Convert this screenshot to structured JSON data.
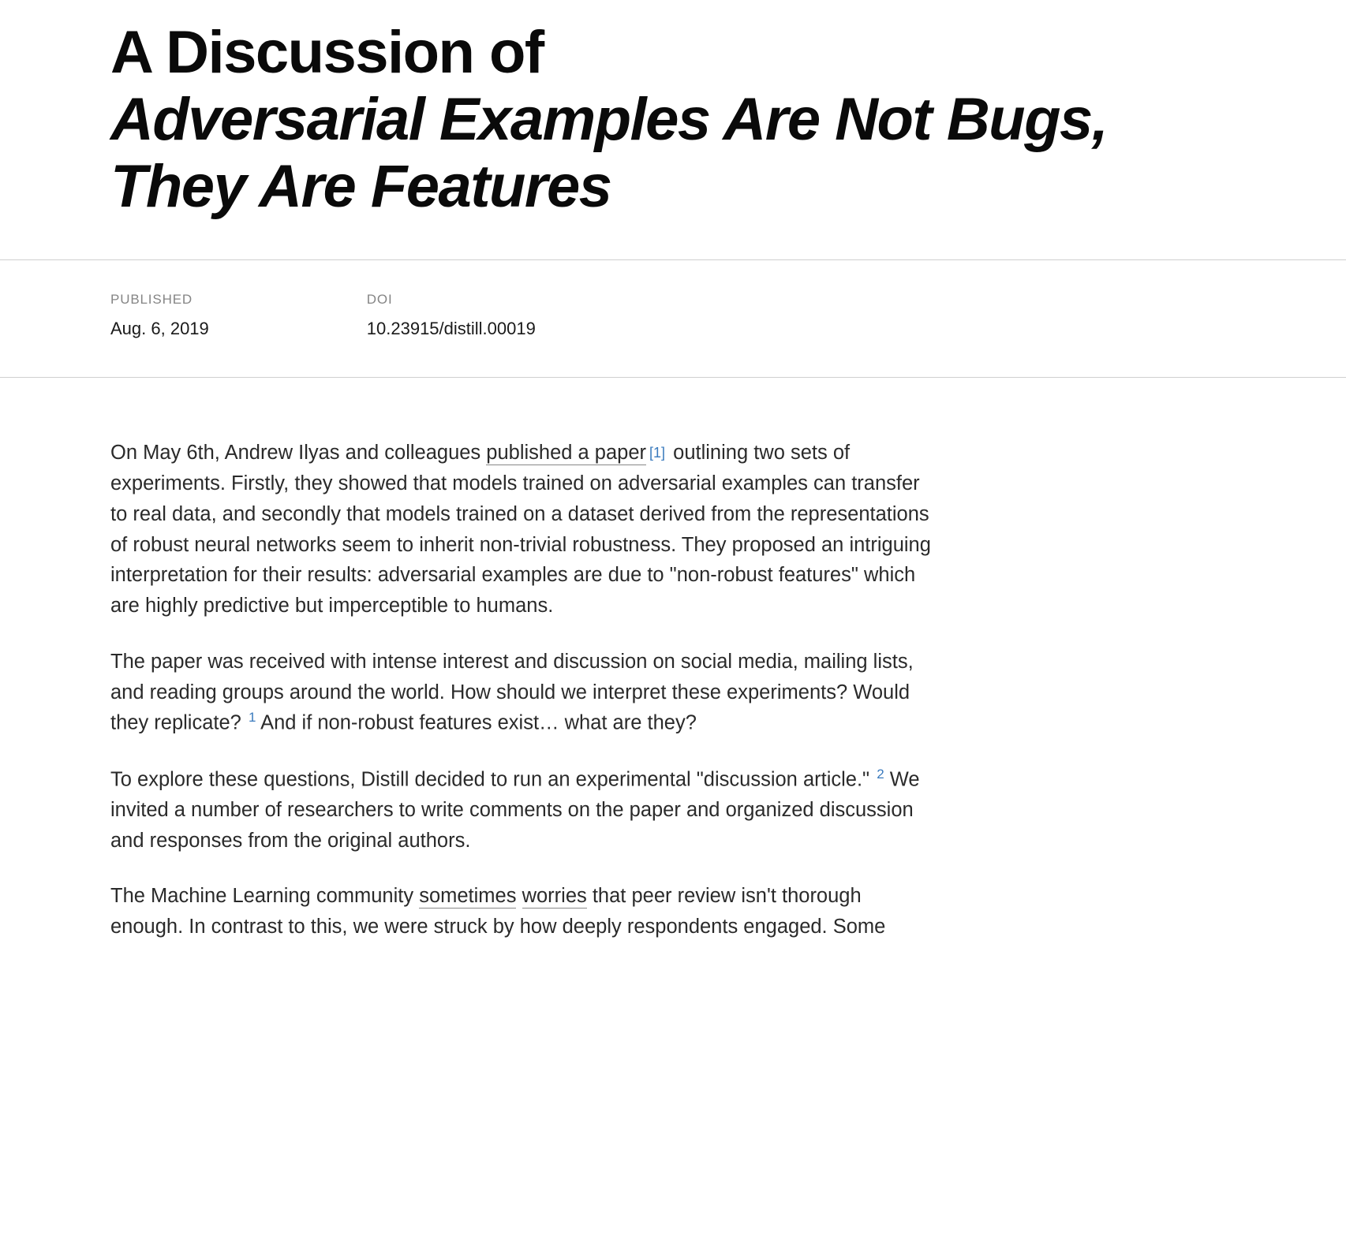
{
  "title": {
    "prefix": "A Discussion of",
    "italic": "Adversarial Examples Are Not Bugs, They Are Features"
  },
  "meta": {
    "published_label": "PUBLISHED",
    "published_value": "Aug. 6, 2019",
    "doi_label": "DOI",
    "doi_value": "10.23915/distill.00019"
  },
  "body": {
    "p1_a": "On May 6th, Andrew Ilyas and colleagues ",
    "p1_link": "published a paper",
    "p1_cite": "[1]",
    "p1_b": " outlining two sets of experiments. Firstly, they showed that models trained on adversarial examples can transfer to real data, and secondly that models trained on a dataset derived from the representations of robust neural networks seem to inherit non-trivial robustness. They proposed an intriguing interpretation for their results: adversarial examples are due to \"non-robust features\" which are highly predictive but imperceptible to humans.",
    "p2_a": "The paper was received with intense interest and discussion on social media, mailing lists, and reading groups around the world. How should we interpret these experiments? Would they replicate? ",
    "p2_fn": "1",
    "p2_b": " And if non-robust features exist… what are they?",
    "p3_a": "To explore these questions, Distill decided to run an experimental \"discussion article.\" ",
    "p3_fn": "2",
    "p3_b": " We invited a number of researchers to write comments on the paper and organized discussion and responses from the original authors.",
    "p4_a": "The Machine Learning community ",
    "p4_link1": "sometimes",
    "p4_mid": " ",
    "p4_link2": "worries",
    "p4_b": " that peer review isn't thorough enough. In contrast to this, we were struck by how deeply respondents engaged. Some"
  }
}
